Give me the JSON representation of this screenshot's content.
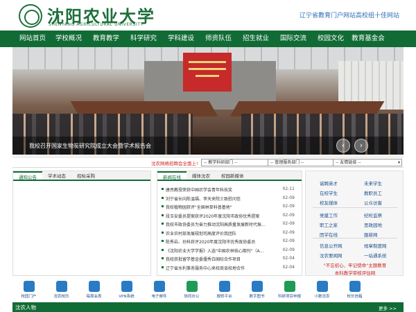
{
  "header": {
    "logo_title": "沈阳农业大学",
    "logo_en": "SHENYANG AGRICULTURAL UNIVERSITY",
    "slogan": "辽宁省教育门户网站高校组十佳网站"
  },
  "nav": {
    "items": [
      "网站首页",
      "学校概况",
      "教育教学",
      "科学研究",
      "学科建设",
      "师资队伍",
      "招生就业",
      "国际交流",
      "校园文化",
      "教育基金会"
    ]
  },
  "banner": {
    "caption": "我校召开国家生物炭研究院成立大会暨学术报告会",
    "prev_label": "‹",
    "next_label": "›"
  },
  "quicklinks": {
    "label": "沈农网络招聘会全面上!",
    "selects": [
      {
        "value": "-- 教学科研部门 --"
      },
      {
        "value": "-- 管理服务部门 --"
      },
      {
        "value": "-- 友情链接 --"
      }
    ],
    "chevron": "▾"
  },
  "panel_left": {
    "tabs": [
      "通知公告",
      "学术动态",
      "招标采购"
    ]
  },
  "panel_mid": {
    "tabs": [
      "新闻在线",
      "媒体沈农",
      "校园新媒体"
    ],
    "news": [
      {
        "title": "唐亮教授荣获中国农学会青年科技奖",
        "date": "02-11"
      },
      {
        "title": "刘宁省长向陈温福、李天来院士致慰问信",
        "date": "02-09"
      },
      {
        "title": "我校植物园获评\"全国林草科普基地\"",
        "date": "02-09"
      },
      {
        "title": "段玉安委员提案获评2020年度沈阳市政协优秀提案",
        "date": "02-09"
      },
      {
        "title": "我校市政协委员为奋力推动沈阳高质量发展新时代振...",
        "date": "02-09"
      },
      {
        "title": "农业农村部发展规划司高度评价我团队",
        "date": "02-09"
      },
      {
        "title": "陈秀岩、孙科获评2020年度沈阳市优秀政协委员",
        "date": "02-09"
      },
      {
        "title": "《沈阳农业大学学报》入选\"中国农林核心期刊\"（A...",
        "date": "02-09"
      },
      {
        "title": "我校获批留学基金委優秀白国际合作项目",
        "date": "02-04"
      },
      {
        "title": "辽宁省水利事务服务中心来校商谈校地合作",
        "date": "02-04"
      }
    ]
  },
  "link_grid": {
    "rows": [
      [
        "诚聘英才",
        "未来学生"
      ],
      [
        "在校学生",
        "教职员工"
      ],
      [
        "校友媒体",
        "公众访客"
      ],
      [
        "党建工作",
        "纪检监察"
      ],
      [
        "职工之家",
        "思政园地"
      ],
      [
        "团学在线",
        "服新网"
      ],
      [
        "信息公开网",
        "规章制度网"
      ],
      [
        "沈农要闻网",
        "一站通系统"
      ]
    ],
    "red_lines": [
      "\"不忘初心、牢记使命\"主题教育",
      "本科教学审核评估网"
    ]
  },
  "icon_bar": {
    "items": [
      {
        "label": "校园门户",
        "icon": "portal-icon",
        "color": "#2a7bc4"
      },
      {
        "label": "沈农校历",
        "icon": "calendar-icon",
        "color": "#2a7bc4"
      },
      {
        "label": "每周会表",
        "icon": "schedule-icon",
        "color": "#2a7bc4"
      },
      {
        "label": "VPN系统",
        "icon": "vpn-icon",
        "color": "#2a7bc4"
      },
      {
        "label": "电子邮件",
        "icon": "mail-icon",
        "color": "#2a7bc4"
      },
      {
        "label": "协同办公",
        "icon": "office-icon",
        "color": "#1f9b57"
      },
      {
        "label": "报修平台",
        "icon": "repair-icon",
        "color": "#2a7bc4"
      },
      {
        "label": "数字图书",
        "icon": "library-icon",
        "color": "#2a7bc4"
      },
      {
        "label": "科研项目申报",
        "icon": "research-icon",
        "color": "#1f9b57"
      },
      {
        "label": "小数沈农",
        "icon": "compass-icon",
        "color": "#2a7bc4"
      },
      {
        "label": "校长信箱",
        "icon": "president-mail-icon",
        "color": "#2a7bc4"
      },
      {
        "label": "",
        "icon": "blank-icon",
        "color": "#ffffff"
      }
    ]
  },
  "bottom": {
    "left": "沈农人物",
    "right": "更多 >>"
  }
}
